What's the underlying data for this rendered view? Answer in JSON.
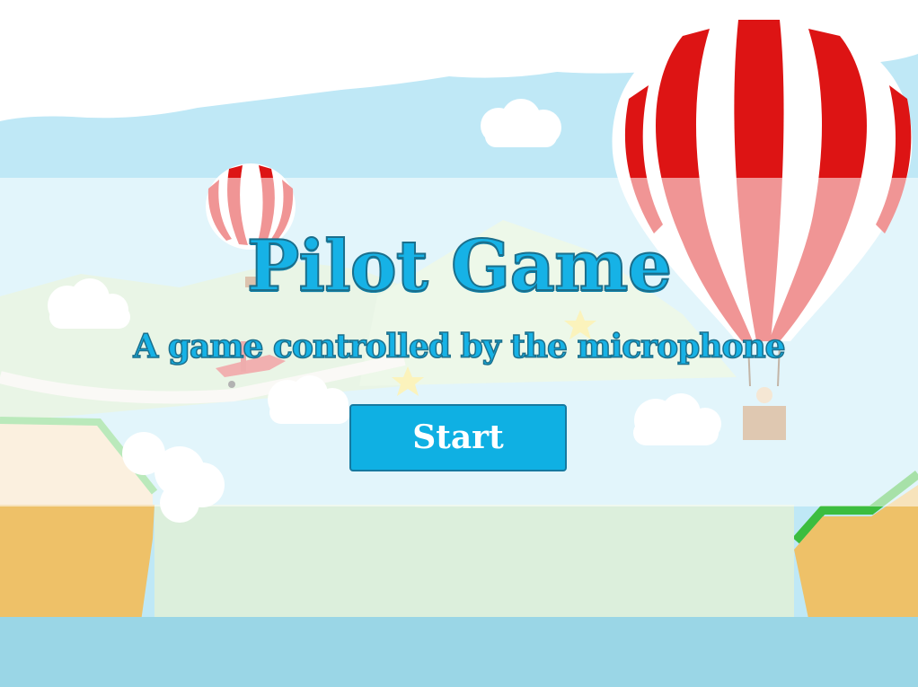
{
  "game": {
    "title": "Pilot Game",
    "subtitle": "A game controlled by the microphone",
    "start_label": "Start"
  },
  "colors": {
    "sky": "#bfe8f6",
    "title": "#16b2e6",
    "button": "#0fb0e3",
    "balloon_red": "#dd1414",
    "cliff": "#eec168",
    "grass": "#58c85a",
    "water": "#9ad6e6"
  },
  "scene_icons": [
    "hot-air-balloon-icon",
    "small-balloon-icon",
    "airplane-icon",
    "star-icon",
    "cloud-icon"
  ]
}
